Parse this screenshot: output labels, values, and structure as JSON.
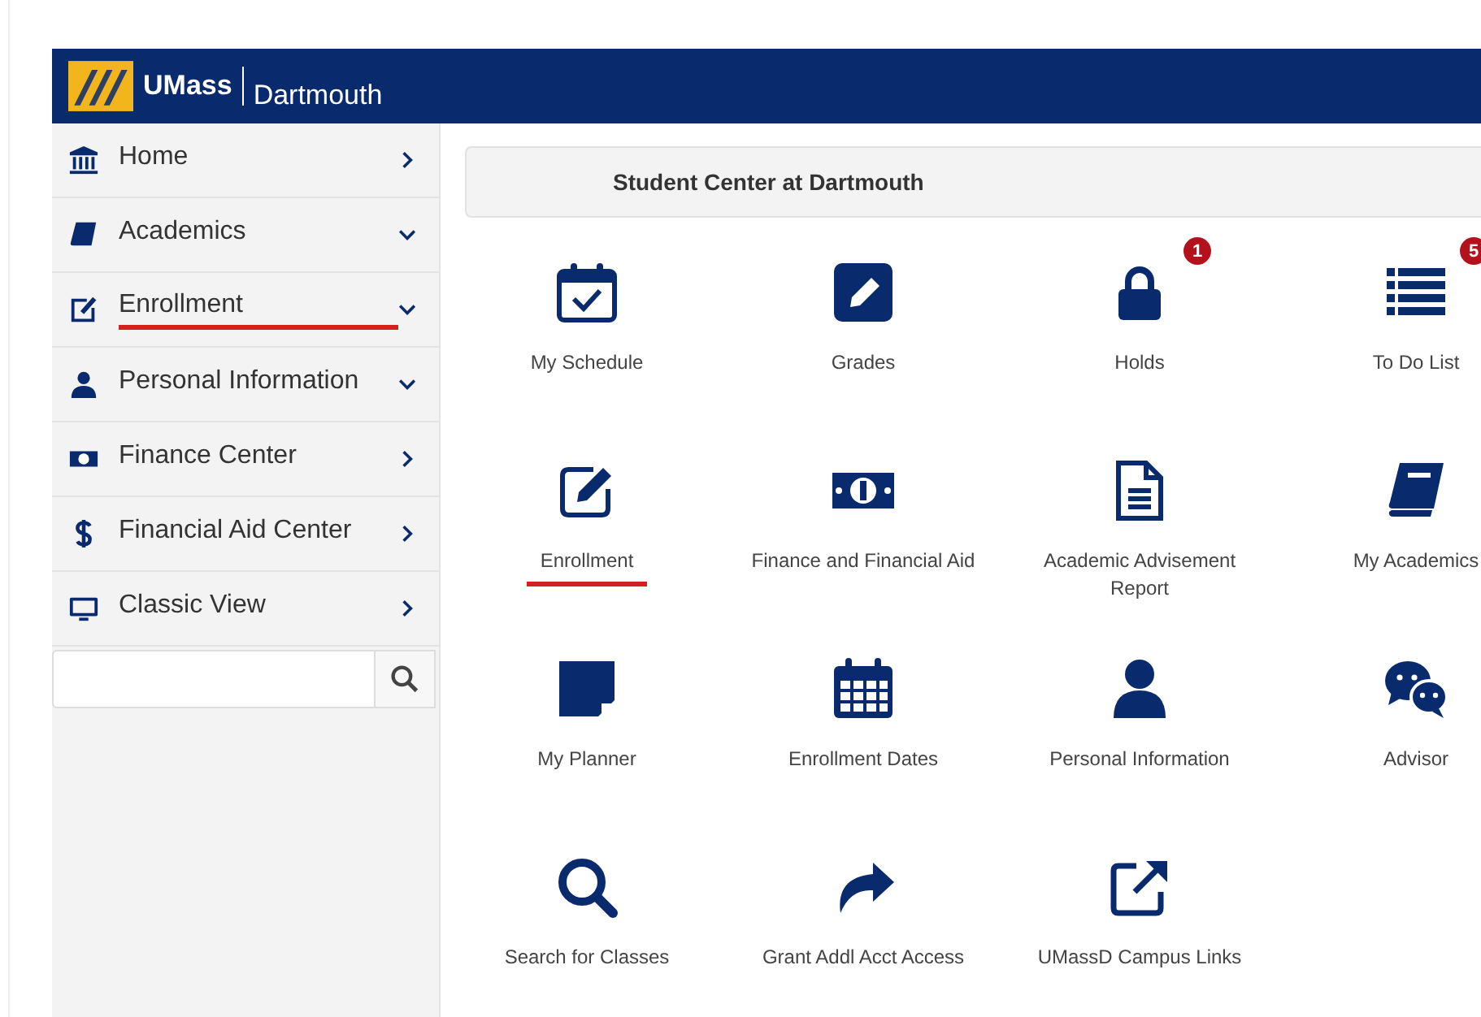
{
  "header": {
    "brand": "UMass",
    "campus": "Dartmouth"
  },
  "sidebar": {
    "items": [
      {
        "label": "Home",
        "kind": "link",
        "annotated": false
      },
      {
        "label": "Academics",
        "kind": "group",
        "annotated": false
      },
      {
        "label": "Enrollment",
        "kind": "group",
        "annotated": true
      },
      {
        "label": "Personal Information",
        "kind": "group",
        "annotated": false
      },
      {
        "label": "Finance Center",
        "kind": "link",
        "annotated": false
      },
      {
        "label": "Financial Aid Center",
        "kind": "link",
        "annotated": false
      },
      {
        "label": "Classic View",
        "kind": "link",
        "annotated": false
      }
    ]
  },
  "title": "Student Center at Dartmouth",
  "tiles": [
    {
      "label": "My Schedule",
      "annotated": false
    },
    {
      "label": "Grades",
      "annotated": false
    },
    {
      "label": "Holds",
      "badge": "1",
      "annotated": false
    },
    {
      "label": "To Do List",
      "badge": "5",
      "annotated": false
    },
    {
      "label": "Enrollment",
      "annotated": true
    },
    {
      "label": "Finance and Financial Aid",
      "annotated": false
    },
    {
      "label": "Academic Advisement Report",
      "annotated": false
    },
    {
      "label": "My Academics",
      "annotated": false
    },
    {
      "label": "My Planner",
      "annotated": false
    },
    {
      "label": "Enrollment Dates",
      "annotated": false
    },
    {
      "label": "Personal Information",
      "annotated": false
    },
    {
      "label": "Advisor",
      "annotated": false
    },
    {
      "label": "Search for Classes",
      "annotated": false
    },
    {
      "label": "Grant Addl Acct Access",
      "annotated": false
    },
    {
      "label": "UMassD Campus Links",
      "annotated": false
    }
  ]
}
